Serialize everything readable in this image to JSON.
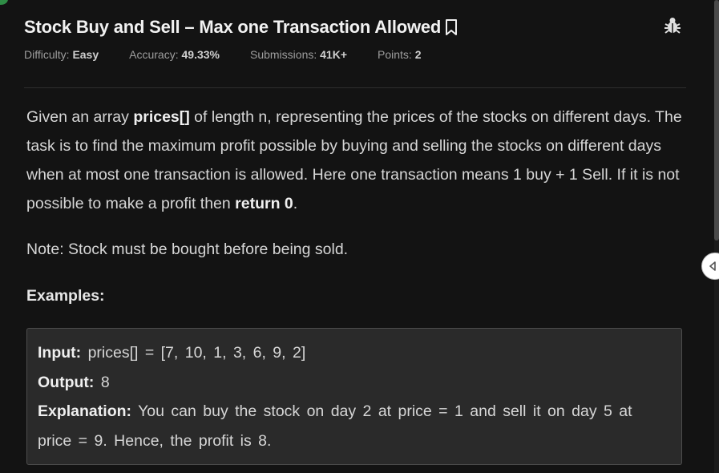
{
  "problem": {
    "title": "Stock Buy and Sell – Max one Transaction Allowed",
    "meta": {
      "difficulty_label": "Difficulty:",
      "difficulty_value": "Easy",
      "accuracy_label": "Accuracy:",
      "accuracy_value": "49.33%",
      "submissions_label": "Submissions:",
      "submissions_value": "41K+",
      "points_label": "Points:",
      "points_value": "2"
    },
    "description": {
      "p1_a": "Given an array ",
      "p1_b": "prices[]",
      "p1_c": " of length n, representing the prices of the stocks on different days. The task is to find the maximum profit possible by buying and selling the stocks on different days when at most one transaction is allowed. Here one transaction means 1 buy + 1 Sell. If it is not possible to make a profit then ",
      "p1_d": "return 0",
      "p1_e": ".",
      "note": "Note: Stock must be bought before being sold.",
      "examples_heading": "Examples:"
    },
    "example": {
      "input_label": "Input:",
      "input_value": "prices[] = [7, 10, 1, 3, 6, 9, 2]",
      "output_label": "Output:",
      "output_value": "8",
      "explanation_label": "Explanation:",
      "explanation_value": "You can buy the stock on day 2 at price = 1 and sell it on day 5 at price = 9. Hence, the profit is 8."
    }
  },
  "icons": {
    "bookmark": "bookmark-icon",
    "bug": "bug-icon",
    "collapse": "chevron-left-icon"
  },
  "colors": {
    "background": "#131313",
    "example_bg": "#2a2a2a",
    "accent": "#2f8d46"
  }
}
